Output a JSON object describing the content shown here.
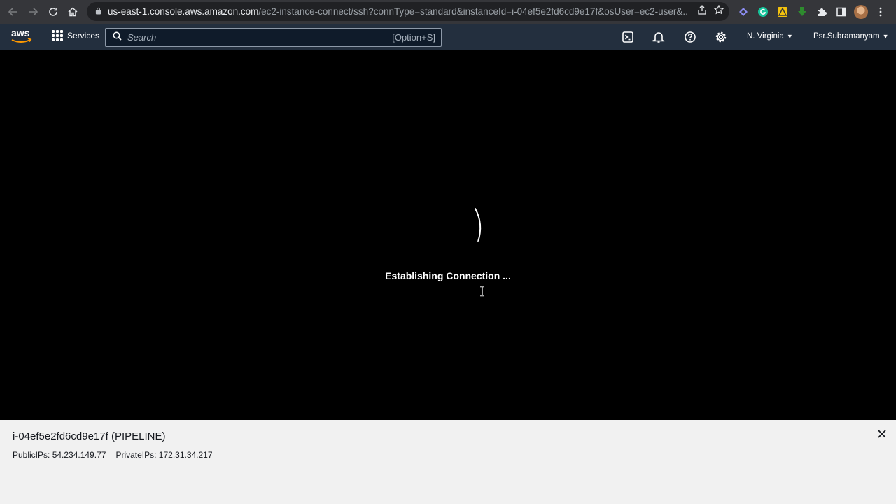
{
  "browser": {
    "url_host": "us-east-1.console.aws.amazon.com",
    "url_path": "/ec2-instance-connect/ssh?connType=standard&instanceId=i-04ef5e2fd6cd9e17f&osUser=ec2-user&..."
  },
  "aws_nav": {
    "logo": "aws",
    "services_label": "Services",
    "search_placeholder": "Search",
    "search_shortcut": "[Option+S]",
    "region_label": "N. Virginia",
    "user_label": "Psr.Subramanyam"
  },
  "terminal": {
    "status_text": "Establishing Connection ..."
  },
  "instance_panel": {
    "title": "i-04ef5e2fd6cd9e17f (PIPELINE)",
    "public_ips": "PublicIPs: 54.234.149.77",
    "private_ips": "PrivateIPs: 172.31.34.217"
  },
  "colors": {
    "aws_nav_bg": "#232f3e",
    "aws_orange": "#ff9900",
    "panel_bg": "#f1f1f1"
  }
}
